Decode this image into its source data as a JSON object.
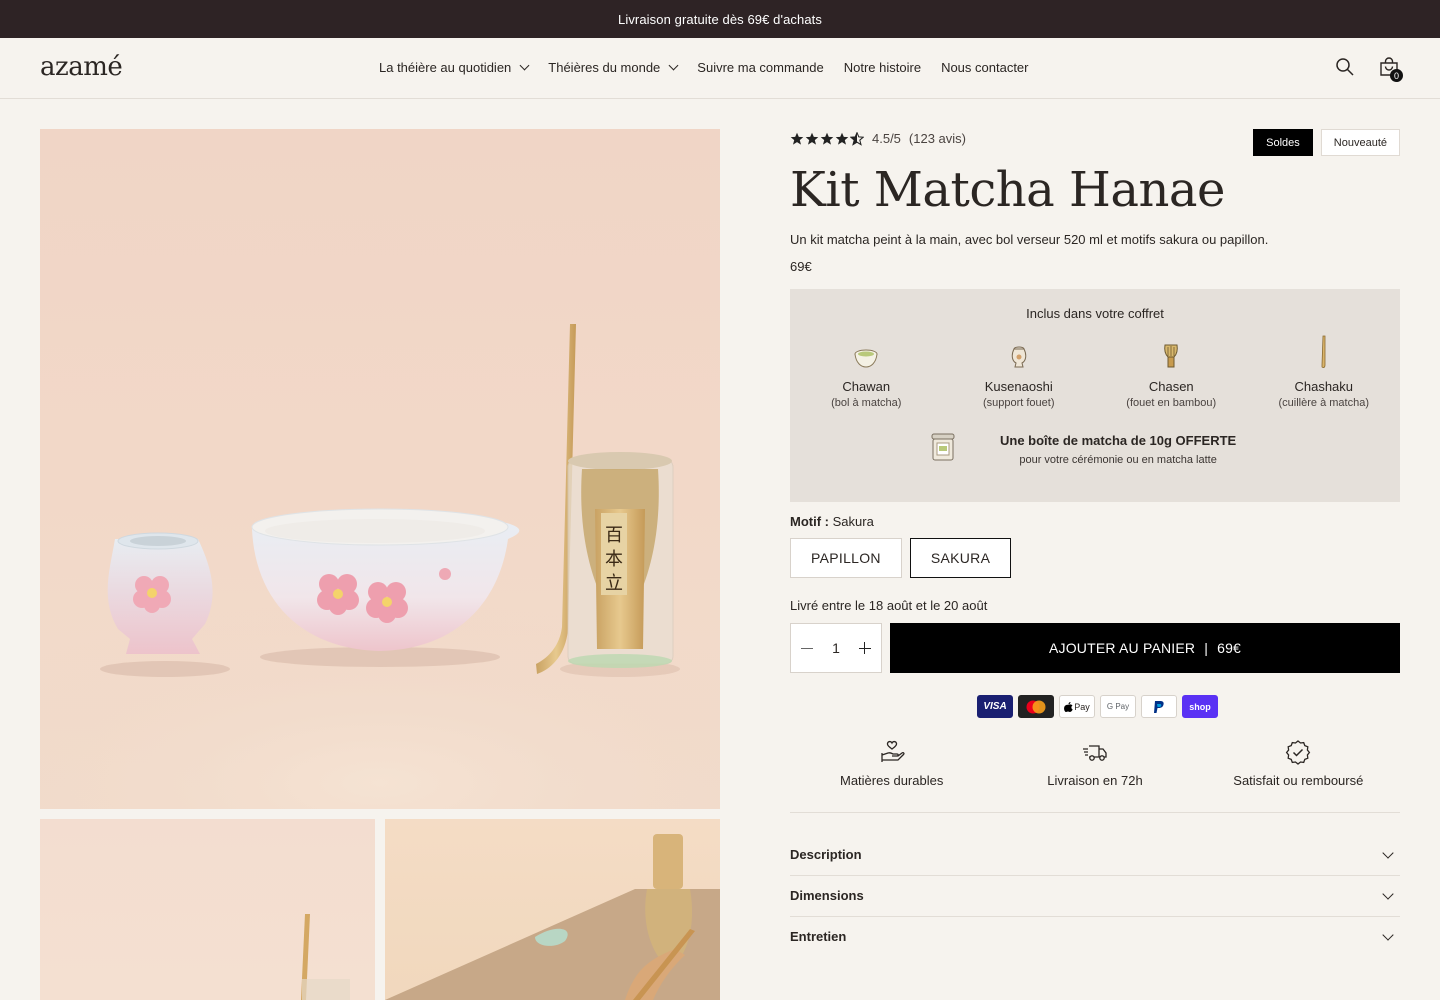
{
  "announcement": "Livraison gratuite dès 69€ d'achats",
  "header": {
    "logo": "azamé",
    "nav": [
      {
        "label": "La théière au quotidien",
        "dropdown": true
      },
      {
        "label": "Théières du monde",
        "dropdown": true
      },
      {
        "label": "Suivre ma commande",
        "dropdown": false
      },
      {
        "label": "Notre histoire",
        "dropdown": false
      },
      {
        "label": "Nous contacter",
        "dropdown": false
      }
    ],
    "cart_count": "0",
    "icons": [
      "search-icon",
      "cart-icon"
    ]
  },
  "product": {
    "rating_text": "4.5/5",
    "reviews_text": "(123 avis)",
    "rating_value": 4.5,
    "badges": {
      "sale": "Soldes",
      "new": "Nouveauté"
    },
    "title": "Kit Matcha Hanae",
    "subtitle": "Un kit matcha peint à la main, avec bol verseur 520 ml et motifs sakura ou papillon.",
    "price": "69€",
    "kit": {
      "title": "Inclus dans votre coffret",
      "items": [
        {
          "name": "Chawan",
          "desc": "(bol à matcha)",
          "icon": "bowl-icon"
        },
        {
          "name": "Kusenaoshi",
          "desc": "(support fouet)",
          "icon": "whisk-holder-icon"
        },
        {
          "name": "Chasen",
          "desc": "(fouet en bambou)",
          "icon": "whisk-icon"
        },
        {
          "name": "Chashaku",
          "desc": "(cuillère à matcha)",
          "icon": "scoop-icon"
        }
      ],
      "gift_title": "Une boîte de matcha de 10g OFFERTE",
      "gift_sub": "pour votre cérémonie ou en matcha latte"
    },
    "motif_label": "Motif :",
    "motif_value": "Sakura",
    "variants": [
      {
        "label": "PAPILLON",
        "selected": false
      },
      {
        "label": "SAKURA",
        "selected": true
      }
    ],
    "delivery": "Livré entre le 18 août et le 20 août",
    "quantity": "1",
    "add_to_cart": "AJOUTER AU PANIER",
    "add_to_cart_sep": "|",
    "add_to_cart_price": "69€",
    "payments": [
      "VISA",
      "Mastercard",
      "Apple Pay",
      "G Pay",
      "PayPal",
      "shop"
    ],
    "features": [
      {
        "label": "Matières durables",
        "icon": "hand-heart-icon"
      },
      {
        "label": "Livraison en 72h",
        "icon": "fast-truck-icon"
      },
      {
        "label": "Satisfait ou remboursé",
        "icon": "badge-check-icon"
      }
    ],
    "accordions": [
      "Description",
      "Dimensions",
      "Entretien"
    ]
  }
}
